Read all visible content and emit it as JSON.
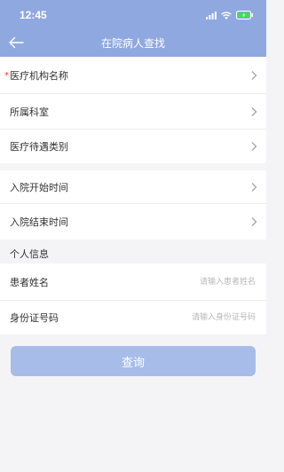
{
  "status_bar": {
    "time": "12:45",
    "icons": [
      "signal-icon",
      "wifi-icon",
      "battery-charging-icon"
    ]
  },
  "nav": {
    "title": "在院病人查找",
    "back_icon": "arrow-left-icon"
  },
  "colors": {
    "header": "#8fa8e0",
    "button": "#a7bce8",
    "required": "#e53935",
    "page_background": "#f4f4f6"
  },
  "select_rows": [
    {
      "label": "医疗机构名称",
      "required": true
    },
    {
      "label": "所属科室",
      "required": false
    },
    {
      "label": "医疗待遇类别",
      "required": false
    },
    {
      "label": "入院开始时间",
      "required": false
    },
    {
      "label": "入院结束时间",
      "required": false
    }
  ],
  "personal_section": {
    "title": "个人信息",
    "fields": [
      {
        "label": "患者姓名",
        "placeholder": "请输入患者姓名",
        "value": ""
      },
      {
        "label": "身份证号码",
        "placeholder": "请输入身份证号码",
        "value": ""
      }
    ]
  },
  "actions": {
    "query_label": "查询"
  }
}
